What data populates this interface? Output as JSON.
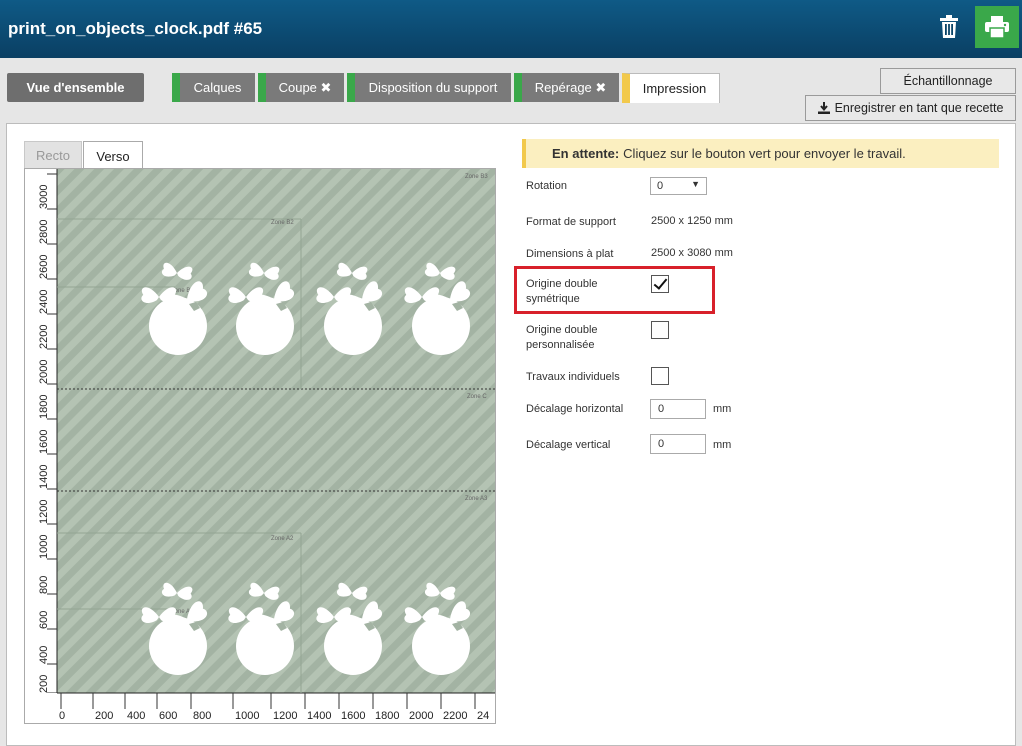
{
  "header": {
    "title": "print_on_objects_clock.pdf #65"
  },
  "colors": {
    "titlebar": "#0a3f63",
    "green": "#3aa84a",
    "yellow": "#f2c94c",
    "highlight": "#d8202a"
  },
  "tabs": {
    "overview": "Vue d'ensemble",
    "calques": "Calques",
    "coupe": "Coupe ✖",
    "disposition": "Disposition du support",
    "reperage": "Repérage ✖",
    "impression": "Impression"
  },
  "buttons": {
    "sampling": "Échantillonnage",
    "save_recipe": "Enregistrer en tant que recette"
  },
  "sides": {
    "recto": "Recto",
    "verso": "Verso"
  },
  "notice": {
    "status": "En attente:",
    "message": "Cliquez sur le bouton vert pour envoyer le travail."
  },
  "form": {
    "rotation_label": "Rotation",
    "rotation_value": "0",
    "media_format_label": "Format de support",
    "media_format_value": "2500 x 1250 mm",
    "flat_dims_label": "Dimensions à plat",
    "flat_dims_value": "2500 x 3080 mm",
    "sym_origin_label_1": "Origine double",
    "sym_origin_label_2": "symétrique",
    "sym_origin_checked": true,
    "custom_origin_label_1": "Origine double",
    "custom_origin_label_2": "personnalisée",
    "custom_origin_checked": false,
    "individual_jobs_label": "Travaux individuels",
    "individual_jobs_checked": false,
    "h_offset_label": "Décalage horizontal",
    "h_offset_value": "0",
    "v_offset_label": "Décalage vertical",
    "v_offset_value": "0",
    "unit": "mm"
  },
  "preview": {
    "zones": [
      "Zone B3",
      "Zone B2",
      "Zone B1",
      "Zone C",
      "Zone A3",
      "Zone A2",
      "Zone A1"
    ],
    "ruler_x": [
      "0",
      "200",
      "400",
      "600",
      "800",
      "1000",
      "1200",
      "1400",
      "1600",
      "1800",
      "2000",
      "2200",
      "24"
    ],
    "ruler_y": [
      "3000",
      "2800",
      "2600",
      "2400",
      "2200",
      "2000",
      "1800",
      "1600",
      "1400",
      "1200",
      "1000",
      "800",
      "600",
      "400",
      "200",
      "0"
    ]
  }
}
